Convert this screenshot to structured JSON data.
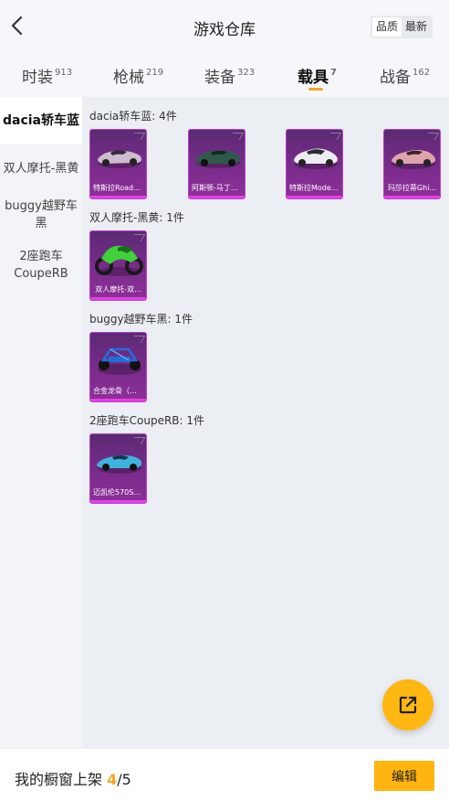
{
  "header": {
    "title": "游戏仓库",
    "sort_options": [
      "品质",
      "最新"
    ]
  },
  "tabs": [
    {
      "label": "时装",
      "count": "913"
    },
    {
      "label": "枪械",
      "count": "219"
    },
    {
      "label": "装备",
      "count": "323"
    },
    {
      "label": "载具",
      "count": "7"
    },
    {
      "label": "战备",
      "count": "162"
    }
  ],
  "active_tab": "载具",
  "sidebar": {
    "items": [
      {
        "label": "dacia轿车蓝"
      },
      {
        "label": "双人摩托-黑黄"
      },
      {
        "label": "buggy越野车黑"
      },
      {
        "label": "2座跑车\nCoupeRB"
      }
    ]
  },
  "groups": [
    {
      "title": "dacia轿车蓝: 4件",
      "items": [
        {
          "label": "特斯拉Roads...",
          "icon": "silver-roadster-car-icon",
          "color": "#c9b8c9"
        },
        {
          "label": "阿斯顿-马丁D...",
          "icon": "green-sports-car-icon",
          "color": "#2f5a4a"
        },
        {
          "label": "特斯拉Model...",
          "icon": "white-sedan-car-icon",
          "color": "#e8e8ee"
        },
        {
          "label": "玛莎拉蒂Ghi...",
          "icon": "pink-coupe-car-icon",
          "color": "#d9a0a8"
        }
      ]
    },
    {
      "title": "双人摩托-黑黄: 1件",
      "items": [
        {
          "label": "双人摩托-双...",
          "icon": "green-motorbike-icon",
          "color": "#3fd13a"
        }
      ]
    },
    {
      "title": "buggy越野车黑: 1件",
      "items": [
        {
          "label": "合金龙骨（蓝...",
          "icon": "blue-buggy-icon",
          "color": "#1f6fd8"
        }
      ]
    },
    {
      "title": "2座跑车CoupeRB: 1件",
      "items": [
        {
          "label": "迈凯伦570S(...",
          "icon": "cyan-supercar-icon",
          "color": "#3fb3df"
        }
      ]
    }
  ],
  "bottom": {
    "shelf_label": "我的橱窗上架",
    "shelf_current": "4",
    "shelf_total": "/5",
    "edit_label": "编辑"
  },
  "colors": {
    "accent": "#ffb711",
    "card_purple": "#7a2c8c",
    "card_border": "#b63fd0"
  }
}
